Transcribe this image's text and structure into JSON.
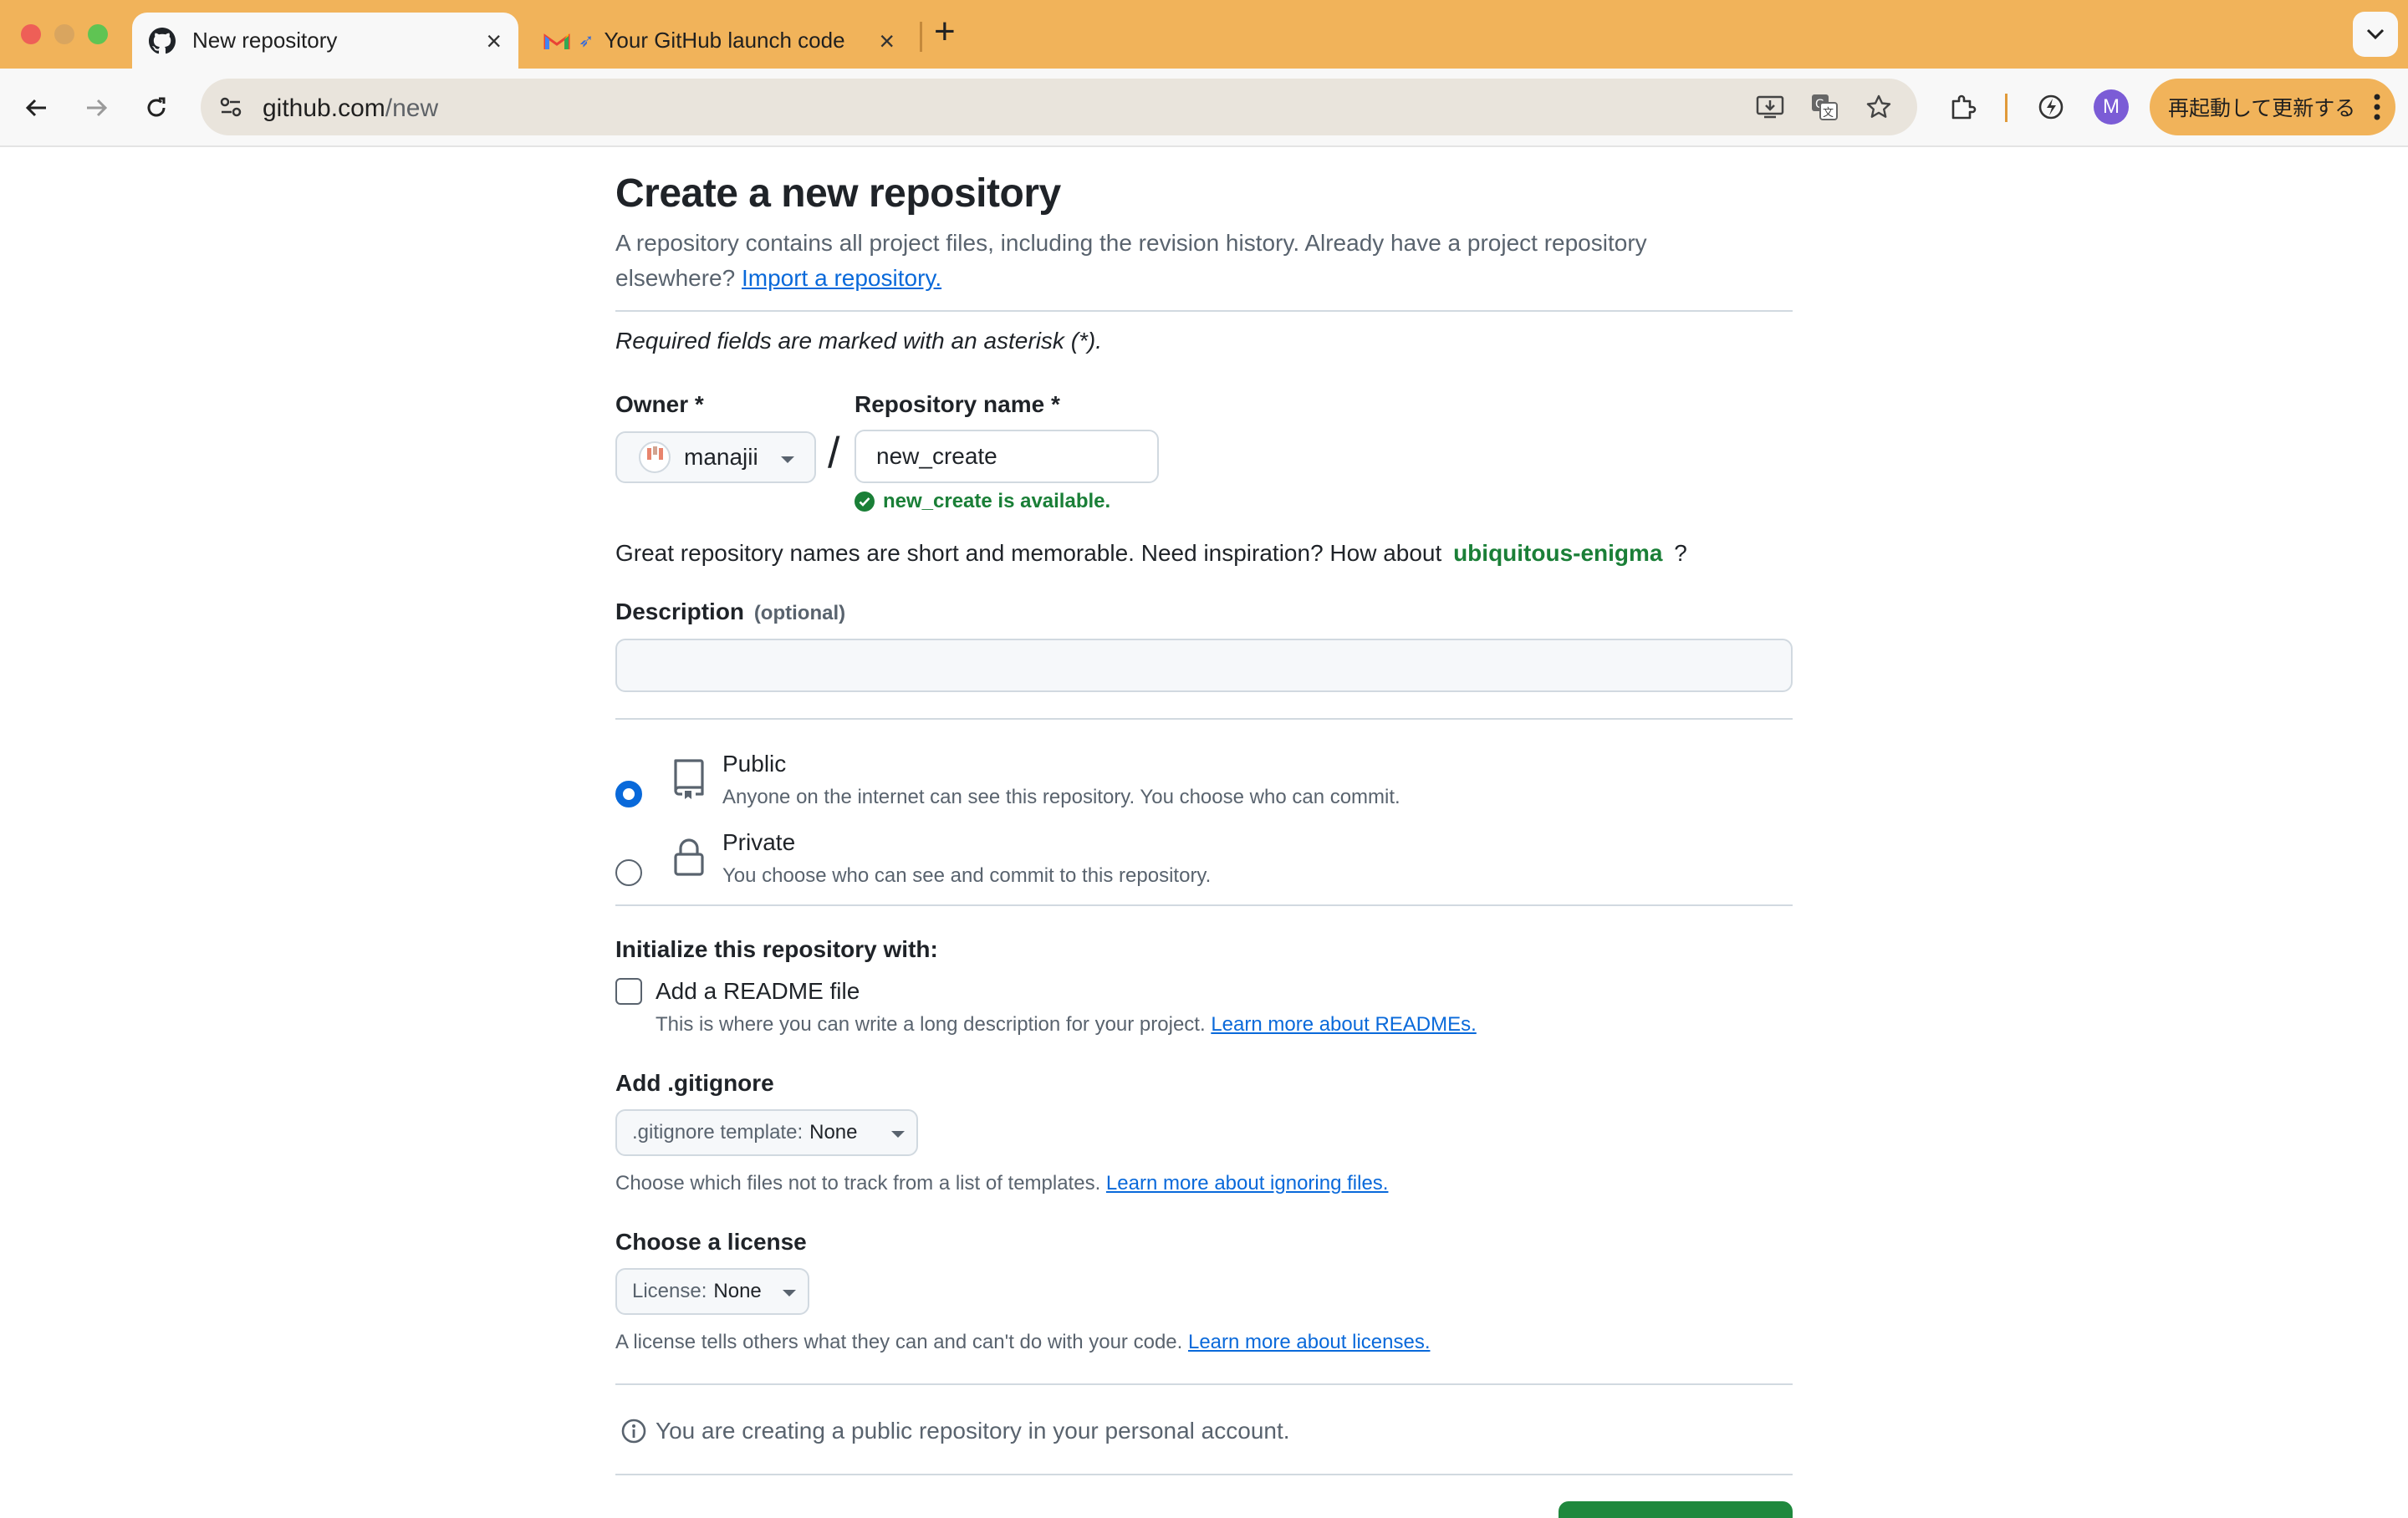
{
  "browser": {
    "tabs": [
      {
        "title": "New repository",
        "active": true,
        "icon": "github-icon"
      },
      {
        "title": "Your GitHub launch code",
        "active": false,
        "icon": "gmail-icon"
      }
    ],
    "url_host": "github.com",
    "url_path": "/new",
    "profile_initial": "M",
    "relaunch_label": "再起動して更新する",
    "colors": {
      "tabbar": "#f1b35a",
      "toolbar": "#f8f8f8"
    }
  },
  "page": {
    "title": "Create a new repository",
    "subtitle_text": "A repository contains all project files, including the revision history. Already have a project repository elsewhere?",
    "import_link": "Import a repository.",
    "required_note": "Required fields are marked with an asterisk (*).",
    "owner": {
      "label": "Owner *",
      "value": "manajii"
    },
    "repo_name": {
      "label": "Repository name *",
      "value": "new_create",
      "availability": "new_create is available."
    },
    "inspiration": {
      "prefix": "Great repository names are short and memorable. Need inspiration? How about",
      "suggestion": "ubiquitous-enigma",
      "suffix": "?"
    },
    "description": {
      "label": "Description",
      "optional": "(optional)",
      "value": ""
    },
    "visibility": [
      {
        "title": "Public",
        "desc": "Anyone on the internet can see this repository. You choose who can commit.",
        "selected": true,
        "icon": "repo-icon"
      },
      {
        "title": "Private",
        "desc": "You choose who can see and commit to this repository.",
        "selected": false,
        "icon": "lock-icon"
      }
    ],
    "init": {
      "heading": "Initialize this repository with:",
      "readme_label": "Add a README file",
      "readme_checked": false,
      "readme_hint": "This is where you can write a long description for your project.",
      "readme_link": "Learn more about READMEs."
    },
    "gitignore": {
      "heading": "Add .gitignore",
      "select_prefix": ".gitignore template:",
      "select_value": "None",
      "hint": "Choose which files not to track from a list of templates.",
      "link": "Learn more about ignoring files."
    },
    "license": {
      "heading": "Choose a license",
      "select_prefix": "License:",
      "select_value": "None",
      "hint": "A license tells others what they can and can't do with your code.",
      "link": "Learn more about licenses."
    },
    "info_note": "You are creating a public repository in your personal account.",
    "colors": {
      "link": "#0969da",
      "success": "#1a7f37",
      "primary_button": "#1f883d"
    }
  }
}
